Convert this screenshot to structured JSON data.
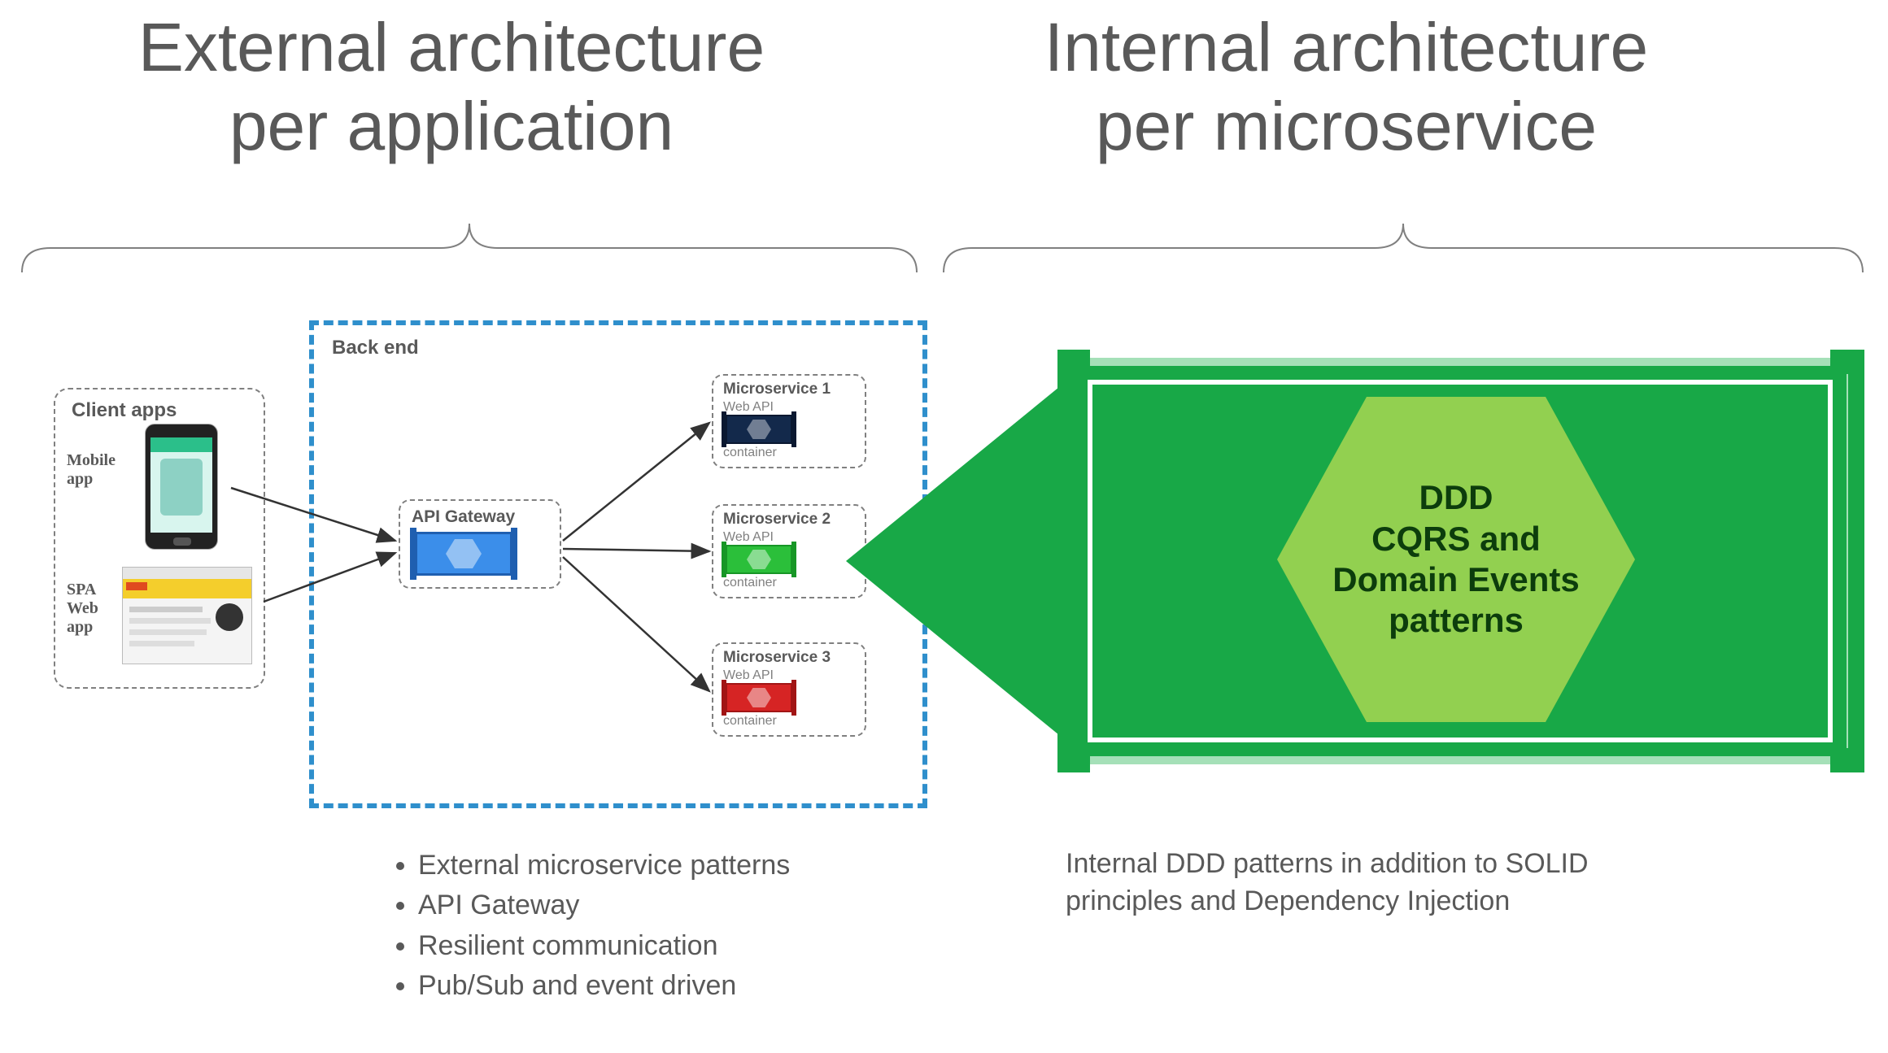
{
  "titles": {
    "left_line1": "External architecture",
    "left_line2": "per application",
    "right_line1": "Internal architecture",
    "right_line2": "per microservice"
  },
  "left": {
    "client_apps_title": "Client apps",
    "mobile_label_l1": "Mobile",
    "mobile_label_l2": "app",
    "spa_label_l1": "SPA",
    "spa_label_l2": "Web",
    "spa_label_l3": "app",
    "backend_title": "Back end",
    "api_gateway": "API Gateway",
    "ms1_title": "Microservice 1",
    "ms2_title": "Microservice 2",
    "ms3_title": "Microservice 3",
    "webapi": "Web API",
    "container": "container",
    "bullets": [
      "External microservice patterns",
      "API Gateway",
      "Resilient communication",
      "Pub/Sub and event driven"
    ]
  },
  "right": {
    "hex_l1": "DDD",
    "hex_l2": "CQRS and",
    "hex_l3": "Domain Events",
    "hex_l4": "patterns",
    "desc": "Internal DDD patterns in addition to SOLID principles and Dependency Injection"
  },
  "colors": {
    "green_dark": "#18A847",
    "green_light": "#92D050",
    "blue": "#2F8FCC",
    "navy": "#13294B",
    "red": "#D62424",
    "ms_green": "#2BBF3A"
  }
}
